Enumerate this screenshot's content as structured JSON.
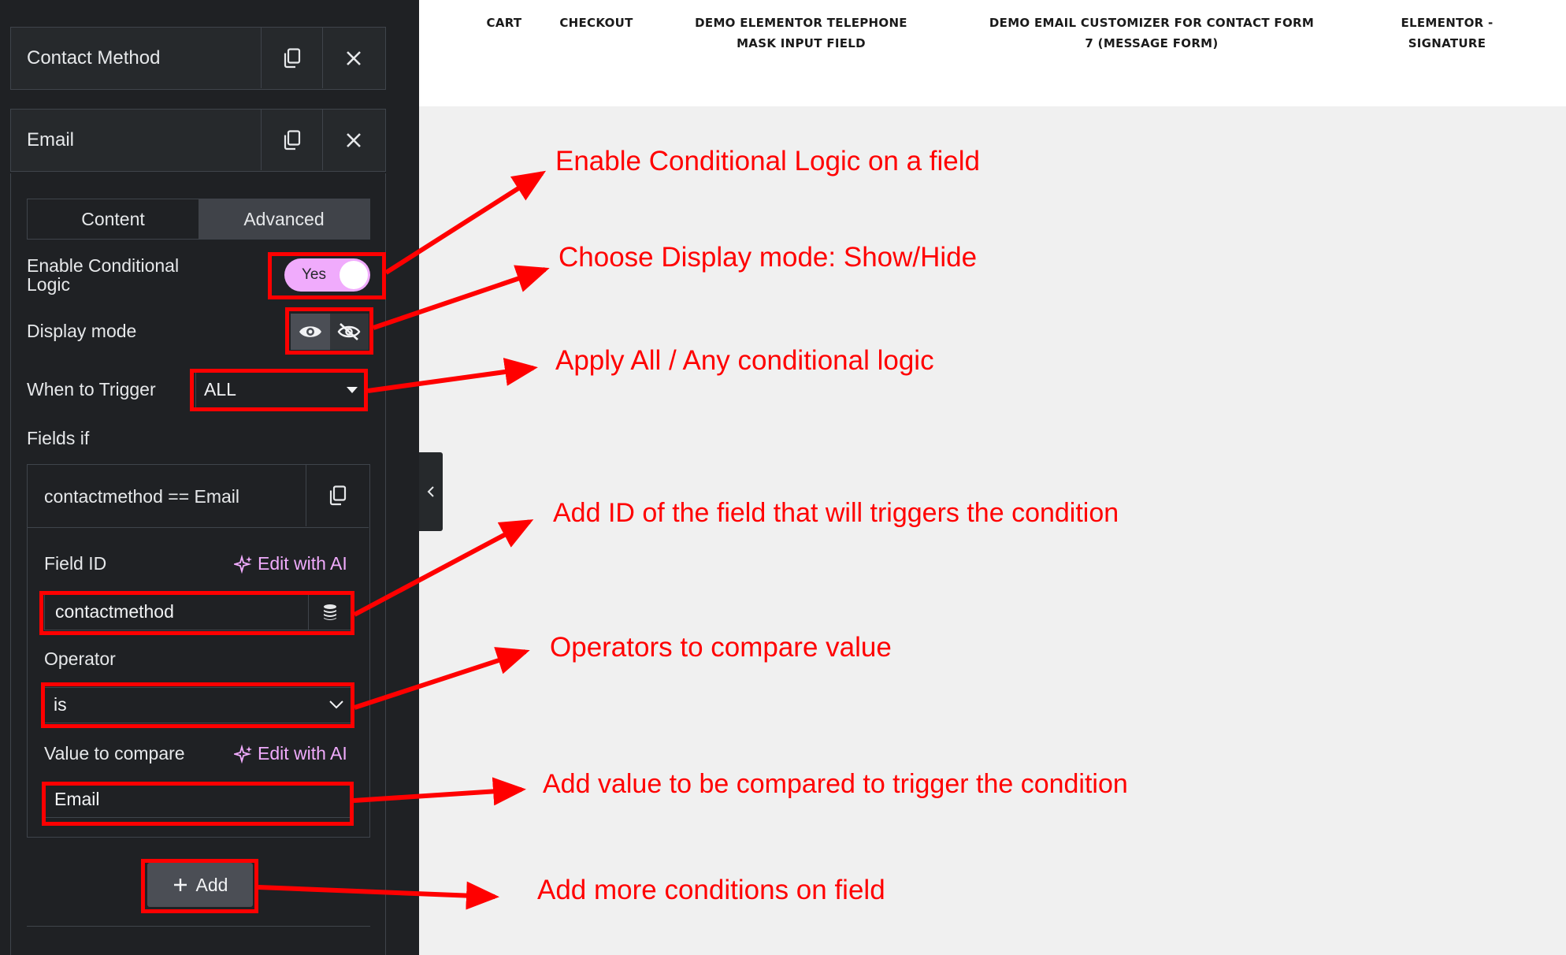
{
  "nav": {
    "items": [
      "CART",
      "CHECKOUT",
      "DEMO ELEMENTOR TELEPHONE MASK INPUT FIELD",
      "DEMO EMAIL CUSTOMIZER FOR CONTACT FORM 7 (MESSAGE FORM)",
      "ELEMENTOR - SIGNATURE"
    ]
  },
  "panel": {
    "items": [
      {
        "title": "Contact Method"
      },
      {
        "title": "Email"
      }
    ],
    "tabs": [
      "Content",
      "Advanced"
    ],
    "active_tab": "Advanced",
    "enable_conditional_label": "Enable Conditional Logic",
    "toggle_value": "Yes",
    "display_mode_label": "Display mode",
    "display_mode_options": [
      "eye-icon",
      "eye-slash-icon"
    ],
    "when_to_trigger_label": "When to Trigger",
    "when_to_trigger_value": "ALL",
    "fields_if_label": "Fields if",
    "condition": {
      "title": "contactmethod == Email",
      "field_id_label": "Field ID",
      "edit_with_ai": "Edit with AI",
      "field_id_value": "contactmethod",
      "operator_label": "Operator",
      "operator_value": "is",
      "value_label": "Value to compare",
      "value": "Email"
    },
    "add_label": "Add"
  },
  "annotations": [
    "Enable Conditional Logic on a field",
    "Choose Display mode: Show/Hide",
    "Apply All / Any conditional logic",
    "Add ID of the field that will triggers the condition",
    "Operators to compare value",
    "Add value to be compared to trigger the condition",
    "Add more conditions on field"
  ],
  "colors": {
    "panel_bg": "#1f2124",
    "accent_pink": "#f0abfc",
    "annotation_red": "#ff0000",
    "canvas_bg": "#f0f0f0"
  }
}
